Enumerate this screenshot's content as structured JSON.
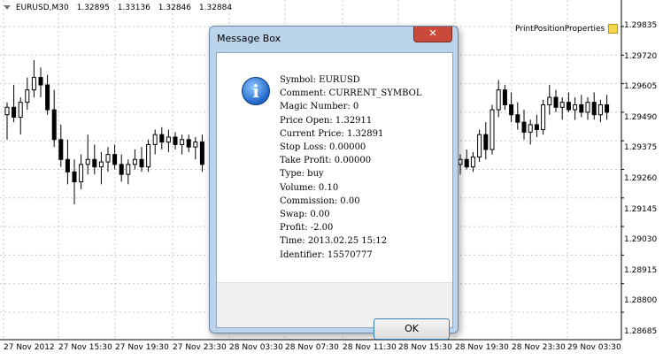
{
  "header": {
    "symbol": "EURUSD,M30",
    "open": "1.32895",
    "high": "1.33136",
    "low": "1.32846",
    "close": "1.32884"
  },
  "indicator": {
    "label": "PrintPositionProperties",
    "icon": "expert-icon"
  },
  "y_axis": [
    "1.29835",
    "1.29720",
    "1.29605",
    "1.29490",
    "1.29375",
    "1.29260",
    "1.29145",
    "1.29030",
    "1.28915",
    "1.28800",
    "1.28685"
  ],
  "x_axis": [
    "27 Nov 2012",
    "27 Nov 15:30",
    "27 Nov 19:30",
    "27 Nov 23:30",
    "28 Nov 03:30",
    "28 Nov 07:30",
    "28 Nov 11:30",
    "28 Nov 15:30",
    "28 Nov 19:30",
    "28 Nov 23:30",
    "29 Nov 03:30"
  ],
  "chart_data": {
    "type": "candlestick",
    "ylim": [
      1.2864,
      1.2992
    ],
    "grid": true,
    "candles_left": [
      {
        "o": 1.2948,
        "h": 1.2953,
        "l": 1.2938,
        "c": 1.2951
      },
      {
        "o": 1.2951,
        "h": 1.296,
        "l": 1.2945,
        "c": 1.2947
      },
      {
        "o": 1.2947,
        "h": 1.2955,
        "l": 1.294,
        "c": 1.2953
      },
      {
        "o": 1.2953,
        "h": 1.2963,
        "l": 1.295,
        "c": 1.2958
      },
      {
        "o": 1.2958,
        "h": 1.297,
        "l": 1.2955,
        "c": 1.2963
      },
      {
        "o": 1.2963,
        "h": 1.2967,
        "l": 1.2955,
        "c": 1.296
      },
      {
        "o": 1.296,
        "h": 1.2964,
        "l": 1.2948,
        "c": 1.295
      },
      {
        "o": 1.295,
        "h": 1.2958,
        "l": 1.2935,
        "c": 1.2938
      },
      {
        "o": 1.2938,
        "h": 1.2944,
        "l": 1.2927,
        "c": 1.293
      },
      {
        "o": 1.293,
        "h": 1.2938,
        "l": 1.292,
        "c": 1.2925
      },
      {
        "o": 1.2925,
        "h": 1.293,
        "l": 1.2912,
        "c": 1.2921
      },
      {
        "o": 1.2921,
        "h": 1.2932,
        "l": 1.2918,
        "c": 1.2928
      },
      {
        "o": 1.2928,
        "h": 1.294,
        "l": 1.2924,
        "c": 1.293
      },
      {
        "o": 1.293,
        "h": 1.2936,
        "l": 1.2924,
        "c": 1.2927
      },
      {
        "o": 1.2927,
        "h": 1.2933,
        "l": 1.292,
        "c": 1.2929
      },
      {
        "o": 1.2929,
        "h": 1.2935,
        "l": 1.2925,
        "c": 1.2932
      },
      {
        "o": 1.2932,
        "h": 1.2936,
        "l": 1.2926,
        "c": 1.2928
      },
      {
        "o": 1.2928,
        "h": 1.2932,
        "l": 1.2921,
        "c": 1.2924
      },
      {
        "o": 1.2924,
        "h": 1.293,
        "l": 1.292,
        "c": 1.2928
      },
      {
        "o": 1.2928,
        "h": 1.2934,
        "l": 1.2926,
        "c": 1.293
      },
      {
        "o": 1.293,
        "h": 1.2935,
        "l": 1.2925,
        "c": 1.2927
      },
      {
        "o": 1.2927,
        "h": 1.2938,
        "l": 1.2925,
        "c": 1.2936
      },
      {
        "o": 1.2936,
        "h": 1.2942,
        "l": 1.2932,
        "c": 1.294
      },
      {
        "o": 1.294,
        "h": 1.2943,
        "l": 1.2934,
        "c": 1.2937
      },
      {
        "o": 1.2937,
        "h": 1.2942,
        "l": 1.2933,
        "c": 1.2939
      },
      {
        "o": 1.2939,
        "h": 1.2941,
        "l": 1.2934,
        "c": 1.2936
      },
      {
        "o": 1.2936,
        "h": 1.294,
        "l": 1.2932,
        "c": 1.2938
      },
      {
        "o": 1.2938,
        "h": 1.294,
        "l": 1.2933,
        "c": 1.2935
      },
      {
        "o": 1.2935,
        "h": 1.2939,
        "l": 1.293,
        "c": 1.2937
      },
      {
        "o": 1.2937,
        "h": 1.294,
        "l": 1.2925,
        "c": 1.2928
      }
    ],
    "candles_right": [
      {
        "o": 1.2928,
        "h": 1.2932,
        "l": 1.2924,
        "c": 1.293
      },
      {
        "o": 1.293,
        "h": 1.2934,
        "l": 1.2926,
        "c": 1.2927
      },
      {
        "o": 1.2927,
        "h": 1.2933,
        "l": 1.2925,
        "c": 1.2931
      },
      {
        "o": 1.2931,
        "h": 1.2942,
        "l": 1.2929,
        "c": 1.294
      },
      {
        "o": 1.294,
        "h": 1.2945,
        "l": 1.293,
        "c": 1.2934
      },
      {
        "o": 1.2934,
        "h": 1.2952,
        "l": 1.2932,
        "c": 1.295
      },
      {
        "o": 1.295,
        "h": 1.2962,
        "l": 1.2947,
        "c": 1.2958
      },
      {
        "o": 1.2958,
        "h": 1.296,
        "l": 1.295,
        "c": 1.2952
      },
      {
        "o": 1.2952,
        "h": 1.2957,
        "l": 1.2945,
        "c": 1.2948
      },
      {
        "o": 1.2948,
        "h": 1.2953,
        "l": 1.2942,
        "c": 1.2945
      },
      {
        "o": 1.2945,
        "h": 1.295,
        "l": 1.2938,
        "c": 1.2941
      },
      {
        "o": 1.2941,
        "h": 1.2946,
        "l": 1.2936,
        "c": 1.2944
      },
      {
        "o": 1.2944,
        "h": 1.2948,
        "l": 1.2939,
        "c": 1.2942
      },
      {
        "o": 1.2942,
        "h": 1.2954,
        "l": 1.294,
        "c": 1.2952
      },
      {
        "o": 1.2952,
        "h": 1.296,
        "l": 1.2948,
        "c": 1.2955
      },
      {
        "o": 1.2955,
        "h": 1.2958,
        "l": 1.2949,
        "c": 1.2951
      },
      {
        "o": 1.2951,
        "h": 1.2955,
        "l": 1.2946,
        "c": 1.2953
      },
      {
        "o": 1.2953,
        "h": 1.2957,
        "l": 1.2949,
        "c": 1.295
      },
      {
        "o": 1.295,
        "h": 1.2955,
        "l": 1.2946,
        "c": 1.2952
      },
      {
        "o": 1.2952,
        "h": 1.2956,
        "l": 1.2947,
        "c": 1.2949
      },
      {
        "o": 1.2949,
        "h": 1.2955,
        "l": 1.2946,
        "c": 1.2953
      },
      {
        "o": 1.2953,
        "h": 1.2957,
        "l": 1.2946,
        "c": 1.2948
      },
      {
        "o": 1.2948,
        "h": 1.2954,
        "l": 1.2945,
        "c": 1.2952
      },
      {
        "o": 1.2952,
        "h": 1.2956,
        "l": 1.2946,
        "c": 1.2949
      }
    ]
  },
  "dialog": {
    "title": "Message Box",
    "close_label": "✕",
    "lines": [
      "Symbol: EURUSD",
      "Comment: CURRENT_SYMBOL",
      "Magic Number: 0",
      "Price Open: 1.32911",
      "Current Price: 1.32891",
      "Stop Loss: 0.00000",
      "Take Profit: 0.00000",
      "Type: buy",
      "Volume: 0.10",
      "Commission: 0.00",
      "Swap: 0.00",
      "Profit: -2.00",
      "Time: 2013.02.25 15:12",
      "Identifier: 15570777"
    ],
    "ok_label": "OK"
  }
}
